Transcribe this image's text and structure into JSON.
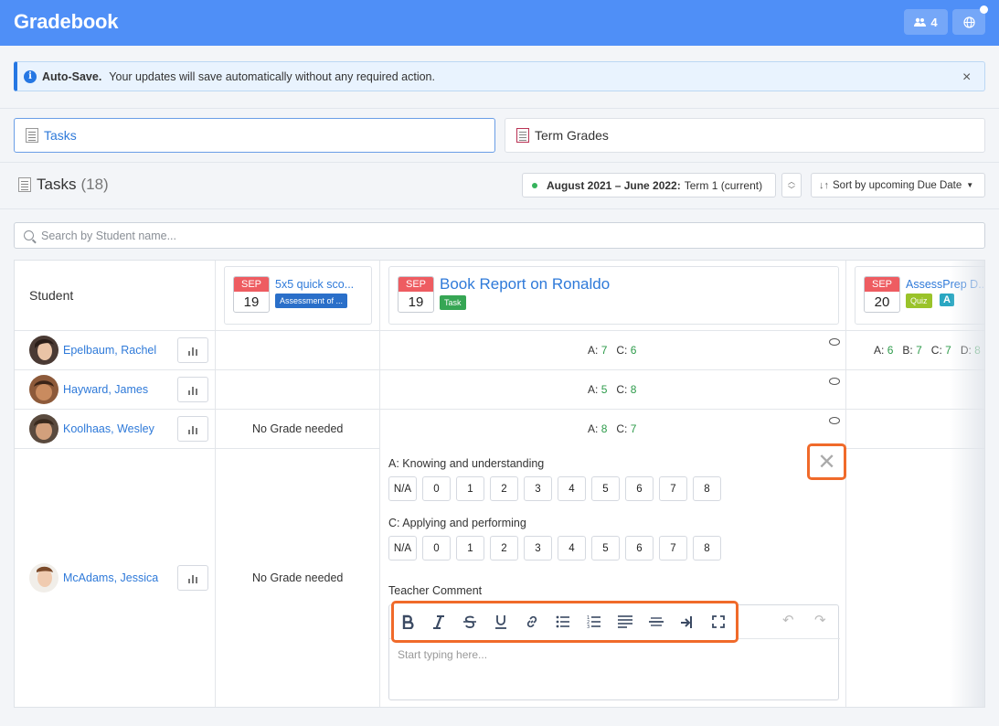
{
  "header": {
    "title": "Gradebook",
    "users_count": "4",
    "users_icon": "users-icon",
    "globe_icon": "globe-icon"
  },
  "alert": {
    "title": "Auto-Save.",
    "message": "Your updates will save automatically without any required action.",
    "close": "×"
  },
  "tabs": [
    {
      "label": "Tasks",
      "icon": "tasks-doc-icon"
    },
    {
      "label": "Term Grades",
      "icon": "term-grades-doc-icon"
    }
  ],
  "section": {
    "title": "Tasks",
    "count": "(18)",
    "term_bold": "August 2021 – June 2022:",
    "term_rest": "Term 1 (current)",
    "sort_label": "Sort by upcoming Due Date"
  },
  "search": {
    "placeholder": "Search by Student name..."
  },
  "table": {
    "student_header": "Student",
    "tasks": [
      {
        "month": "SEP",
        "day": "19",
        "title": "5x5 quick sco...",
        "badge": "Assessment of ...",
        "badge_color": "#2a6fc9"
      },
      {
        "month": "SEP",
        "day": "19",
        "title": "Book Report on Ronaldo",
        "badge": "Task",
        "badge_color": "#36a654"
      },
      {
        "month": "SEP",
        "day": "20",
        "title": "AssessPrep D...",
        "badge": "Quiz",
        "badge_color": "#9ac32a",
        "badge2": "A",
        "badge2_color": "#2aa7c2"
      }
    ],
    "students": [
      {
        "name": "Epelbaum, Rachel",
        "task1": "",
        "task2": [
          {
            "label": "A:",
            "value": "7"
          },
          {
            "label": "C:",
            "value": "6"
          }
        ],
        "task3": [
          {
            "label": "A:",
            "value": "6"
          },
          {
            "label": "B:",
            "value": "7"
          },
          {
            "label": "C:",
            "value": "7"
          },
          {
            "label": "D:",
            "value": "8"
          }
        ]
      },
      {
        "name": "Hayward, James",
        "task1": "",
        "task2": [
          {
            "label": "A:",
            "value": "5"
          },
          {
            "label": "C:",
            "value": "8"
          }
        ]
      },
      {
        "name": "Koolhaas, Wesley",
        "task1": "No Grade needed",
        "task2": [
          {
            "label": "A:",
            "value": "8"
          },
          {
            "label": "C:",
            "value": "7"
          }
        ]
      },
      {
        "name": "McAdams, Jessica",
        "task1": "No Grade needed"
      }
    ]
  },
  "editor": {
    "criteria": [
      {
        "label": "A: Knowing and understanding"
      },
      {
        "label": "C: Applying and performing"
      }
    ],
    "options": [
      "N/A",
      "0",
      "1",
      "2",
      "3",
      "4",
      "5",
      "6",
      "7",
      "8"
    ],
    "comment_label": "Teacher Comment",
    "comment_placeholder": "Start typing here...",
    "close_symbol": "✕"
  },
  "colors": {
    "header_bg": "#4f8ff7",
    "link": "#2f7ad9",
    "grade_value": "#2d9b4a",
    "highlight": "#f06a2a"
  }
}
